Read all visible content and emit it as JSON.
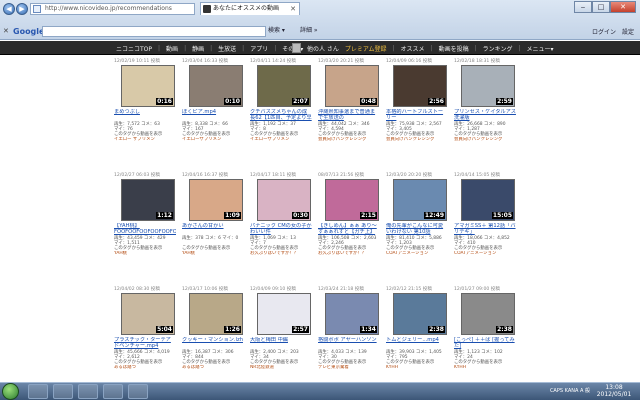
{
  "browser": {
    "address": "http://www.nicovideo.jp/recommendations",
    "tab_title": "あなたにオススメの動画",
    "back_symbol": "◀",
    "fwd_symbol": "▶",
    "close_tab_symbol": "✕",
    "window_buttons": [
      "‒",
      "□",
      "✕"
    ]
  },
  "google_bar": {
    "x_symbol": "✕",
    "logo": "Google",
    "search_label": "検索 ▾",
    "more_label": "詳細 »",
    "login_label": "ログイン",
    "settings_label": "設定"
  },
  "nico_nav": {
    "items": [
      "ニコニコTOP",
      "動画",
      "静画",
      "生放送",
      "アプリ",
      "その他▾"
    ],
    "user": "他の人 さん",
    "premium": "プレミアム登録",
    "right_items": [
      "オススメ",
      "動画を投稿",
      "ランキング",
      "メニュー▾"
    ]
  },
  "videos": [
    {
      "date": "12/02/19 10:11 投稿",
      "dur": "0:16",
      "title": "まめつぶし",
      "stat1": "再生：7,572 コメ：63",
      "stat2": "マイ：76",
      "note": "このタグから動画を表示",
      "chan": "イエロー ザブリメン",
      "bg": "#d8c9a8"
    },
    {
      "date": "12/03/04 16:33 投稿",
      "dur": "0:10",
      "title": "ぼくピア.mp4",
      "stat1": "再生：8,338 コメ：66",
      "stat2": "マイ：167",
      "note": "このタグから動画を表示",
      "chan": "イエローザブリメン",
      "bg": "#8a7d72"
    },
    {
      "date": "12/04/11 14:24 投稿",
      "dur": "2:07",
      "title": "クチバスズメちゃんの成長62【1匹目、予定より早い羽化】",
      "stat1": "再生：1,192 コメ：37",
      "stat2": "マイ：8",
      "note": "このタグから動画を表示",
      "chan": "イエローザブリメン",
      "bg": "#6e6a4a"
    },
    {
      "date": "12/03/20 20:21 投稿",
      "dur": "0:48",
      "title": "沖縄県知事選まで普通まで生放送の",
      "stat1": "再生：44,042 コメ：346",
      "stat2": "マイ：4,594",
      "note": "このタグから動画を表示",
      "chan": "会員向けパンクレシング",
      "bg": "#c7a48a"
    },
    {
      "date": "12/04/09 06:16 投稿",
      "dur": "2:56",
      "title": "本格的ハートフルストーリー",
      "stat1": "再生：75,938 コメ：2,567",
      "stat2": "マイ：3,405",
      "note": "このタグから動画を表示",
      "chan": "会員向けパンクレシング",
      "bg": "#4a3a30"
    },
    {
      "date": "12/02/18 18:31 投稿",
      "dur": "2:59",
      "title": "プリンセス・ケイタルアス洗濯版",
      "stat1": "再生：26,668 コメ：890",
      "stat2": "マイ：1,287",
      "note": "このタグから動画を表示",
      "chan": "会員向けパンクレシング",
      "bg": "#a8b0b8"
    },
    {
      "date": "12/02/27 06:03 投稿",
      "dur": "1:12",
      "title": "【YAH桃】FOOFOOFOOFOOFOOFOOFOO！",
      "stat1": "再生：43,459 コメ：429",
      "stat2": "マイ：1,511",
      "note": "このタグから動画を表示",
      "chan": "YAH桃",
      "bg": "#3a3e4a"
    },
    {
      "date": "12/04/16 16:37 投稿",
      "dur": "1:09",
      "title": "あかさんの甘かい",
      "stat1": "再生：378 コメ：6 マイ：0",
      "stat2": "",
      "note": "このタグから動画を表示",
      "chan": "YAH桃",
      "bg": "#d8a888"
    },
    {
      "date": "12/04/17 18:11 投稿",
      "dur": "0:30",
      "title": "パナニック CMの女の子かわいい件",
      "stat1": "再生：1,069 コメ：13",
      "stat2": "マイ：7",
      "note": "このタグから動画を表示",
      "chan": "お久ぶりはいですか！？",
      "bg": "#d9b3c4"
    },
    {
      "date": "08/07/13 21:56 投稿",
      "dur": "2:15",
      "title": "【きしめん】ぁぁ あり～すぁぁれすと【ガチ上】",
      "stat1": "再生：106,508 コメ：2,603",
      "stat2": "マイ：2,246",
      "note": "このタグから動画を表示",
      "chan": "お久ぶりはいですか！？",
      "bg": "#c06a9a"
    },
    {
      "date": "12/03/20 20:20 投稿",
      "dur": "12:49",
      "title": "俺の先輩がこんなに可愛いわけない 第10話",
      "stat1": "再生：81,410 コメ：5,886",
      "stat2": "マイ：1,203",
      "note": "このタグから動画を表示",
      "chan": "COATアニメーション",
      "bg": "#6a8ab0"
    },
    {
      "date": "12/04/14 15:05 投稿",
      "dur": "15:05",
      "title": "アマガミSS＋ 第12話「バリテギ」",
      "stat1": "再生：18,066 コメ：4,852",
      "stat2": "マイ：410",
      "note": "このタグから動画を表示",
      "chan": "COATアニメーション",
      "bg": "#3a4a6a"
    },
    {
      "date": "12/04/02 08:30 投稿",
      "dur": "5:04",
      "title": "プラスチック・ターテアドベンチャー.mp4",
      "stat1": "再生：45,666 コメ：4,019",
      "stat2": "マイ：2,612",
      "note": "このタグから動画を表示",
      "chan": "あるは踏つ",
      "bg": "#c8b8a0"
    },
    {
      "date": "12/03/17 10:06 投稿",
      "dur": "1:26",
      "title": "クッキー・マンション.lzh",
      "stat1": "再生：16,387 コメ：306",
      "stat2": "マイ：844",
      "note": "このタグから動画を表示",
      "chan": "あるは踏つ",
      "bg": "#b8a888"
    },
    {
      "date": "12/04/09 09:10 投稿",
      "dur": "2:57",
      "title": "大阪と梅田 中編",
      "stat1": "再生：2,400 コメ：203",
      "stat2": "マイ：34",
      "note": "このタグから動画を表示",
      "chan": "NR北陸鉄道",
      "bg": "#e8e8f0"
    },
    {
      "date": "12/03/24 21:18 投稿",
      "dur": "1:34",
      "title": "格闘ボボ アヤーハンソン",
      "stat1": "再生：4,033 コメ：139",
      "stat2": "マイ：30",
      "note": "このタグから動画を表示",
      "chan": "テレビ東京驚着",
      "bg": "#7a8ab0"
    },
    {
      "date": "12/02/12 21:15 投稿",
      "dur": "2:38",
      "title": "トムとジェリー...mp4",
      "stat1": "再生：39,903 コメ：1,405",
      "stat2": "マイ：795",
      "note": "このタグから動画を表示",
      "chan": "KYHH",
      "bg": "#5a7a9a"
    },
    {
      "date": "12/01/27 09:00 投稿",
      "dur": "2:38",
      "title": "[こっぺ] ＋＋ば [握ってみた]",
      "stat1": "再生：1,123 コメ：102",
      "stat2": "マイ：24",
      "note": "このタグから動画を表示",
      "chan": "KYHH",
      "bg": "#8a8a8a"
    }
  ],
  "taskbar": {
    "time": "13:08",
    "date": "2012/05/01",
    "tray": "CAPS KANA A 般"
  }
}
